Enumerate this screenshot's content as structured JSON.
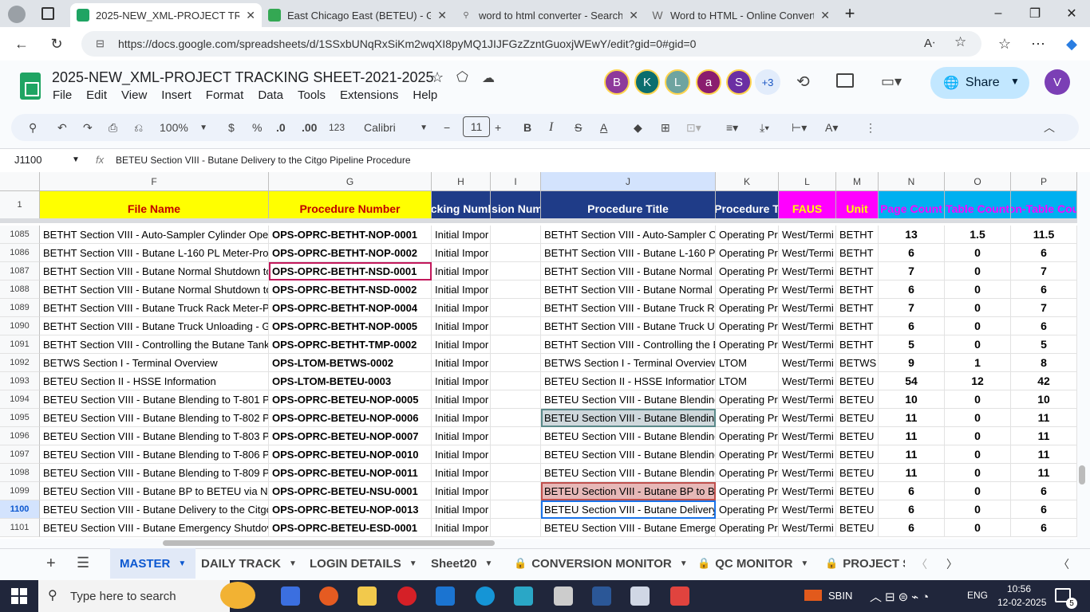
{
  "browser": {
    "tabs": [
      {
        "label": "2025-NEW_XML-PROJECT TRACKI",
        "active": true
      },
      {
        "label": "East Chicago East (BETEU) - Goog",
        "active": false
      },
      {
        "label": "word to html converter - Search",
        "active": false
      },
      {
        "label": "Word to HTML - Online Convert",
        "active": false
      }
    ],
    "url": "https://docs.google.com/spreadsheets/d/1SSxbUNqRxSiKm2wqXI8pyMQ1JIJFGzZzntGuoxjWEwY/edit?gid=0#gid=0"
  },
  "sheet": {
    "title": "2025-NEW_XML-PROJECT TRACKING SHEET-2021-2025",
    "menu": [
      "File",
      "Edit",
      "View",
      "Insert",
      "Format",
      "Data",
      "Tools",
      "Extensions",
      "Help"
    ],
    "avatars": [
      {
        "letter": "B",
        "color": "#8e3a9b"
      },
      {
        "letter": "K",
        "color": "#0b6e6e"
      },
      {
        "letter": "L",
        "color": "#6ea4a0"
      },
      {
        "letter": "a",
        "color": "#8a1d6f"
      },
      {
        "letter": "S",
        "color": "#6b2fa3"
      },
      {
        "letter": "+3",
        "color": "#e2ecfb"
      }
    ],
    "share_label": "Share",
    "user_avatar": "V"
  },
  "toolbar": {
    "zoom": "100%",
    "currency": "$",
    "percent": "%",
    "dec_minus": ".0",
    "dec_plus": ".00",
    "number_format": "123",
    "font": "Calibri",
    "font_size": "11"
  },
  "formula_bar": {
    "cell_ref": "J1100",
    "fx": "fx",
    "content": "BETEU Section VIII - Butane Delivery to the Citgo Pipeline Procedure"
  },
  "columns": [
    {
      "letter": "F",
      "header": "File Name",
      "bg": "#ffff00",
      "color": "#c00000"
    },
    {
      "letter": "G",
      "header": "Procedure Number",
      "bg": "#ffff00",
      "color": "#c00000"
    },
    {
      "letter": "H",
      "header": "cking Numl",
      "bg": "#1f3c88",
      "color": "#ffffff"
    },
    {
      "letter": "I",
      "header": "ision Num",
      "bg": "#1f3c88",
      "color": "#ffffff"
    },
    {
      "letter": "J",
      "header": "Procedure Title",
      "bg": "#1f3c88",
      "color": "#ffffff"
    },
    {
      "letter": "K",
      "header": "Procedure T",
      "bg": "#1f3c88",
      "color": "#ffffff"
    },
    {
      "letter": "L",
      "header": "FAUS",
      "bg": "#ff00ff",
      "color": "#ffff00"
    },
    {
      "letter": "M",
      "header": "Unit",
      "bg": "#ff00ff",
      "color": "#ffff00"
    },
    {
      "letter": "N",
      "header": "Page Count",
      "bg": "#00b0f0",
      "color": "#ff00ff"
    },
    {
      "letter": "O",
      "header": "Table Count",
      "bg": "#00b0f0",
      "color": "#ff00ff"
    },
    {
      "letter": "P",
      "header": "on-Table Cou",
      "bg": "#00b0f0",
      "color": "#ff00ff"
    }
  ],
  "header_row_number": "1",
  "rows": [
    {
      "n": "1085",
      "F": "BETHT Section VIII - Auto-Sampler Cylinder Ope",
      "G": "OPS-OPRC-BETHT-NOP-0001",
      "H": "Initial Impor",
      "I": "",
      "J": "BETHT Section VIII - Auto-Sampler Cy",
      "K": "Operating Pr",
      "L": "West/Termi",
      "M": "BETHT",
      "N": "13",
      "O": "1.5",
      "P": "11.5"
    },
    {
      "n": "1086",
      "F": "BETHT Section VIII - Butane L-160 PL Meter-Prov",
      "G": "OPS-OPRC-BETHT-NOP-0002",
      "H": "Initial Impor",
      "I": "",
      "J": "BETHT Section VIII - Butane L-160 PL",
      "K": "Operating Pr",
      "L": "West/Termi",
      "M": "BETHT",
      "N": "6",
      "O": "0",
      "P": "6"
    },
    {
      "n": "1087",
      "F": "BETHT Section VIII - Butane Normal Shutdown to",
      "G": "OPS-OPRC-BETHT-NSD-0001",
      "H": "Initial Impor",
      "I": "",
      "J": "BETHT Section VIII - Butane Normal S",
      "K": "Operating Pr",
      "L": "West/Termi",
      "M": "BETHT",
      "N": "7",
      "O": "0",
      "P": "7"
    },
    {
      "n": "1088",
      "F": "BETHT Section VIII - Butane Normal Shutdown to",
      "G": "OPS-OPRC-BETHT-NSD-0002",
      "H": "Initial Impor",
      "I": "",
      "J": "BETHT Section VIII - Butane Normal S",
      "K": "Operating Pr",
      "L": "West/Termi",
      "M": "BETHT",
      "N": "6",
      "O": "0",
      "P": "6"
    },
    {
      "n": "1089",
      "F": "BETHT Section VIII - Butane Truck Rack Meter-Pr",
      "G": "OPS-OPRC-BETHT-NOP-0004",
      "H": "Initial Impor",
      "I": "",
      "J": "BETHT Section VIII - Butane Truck Ra",
      "K": "Operating Pr",
      "L": "West/Termi",
      "M": "BETHT",
      "N": "7",
      "O": "0",
      "P": "7"
    },
    {
      "n": "1090",
      "F": "BETHT Section VIII - Butane Truck Unloading - G",
      "G": "OPS-OPRC-BETHT-NOP-0005",
      "H": "Initial Impor",
      "I": "",
      "J": "BETHT Section VIII - Butane Truck Ur",
      "K": "Operating Pr",
      "L": "West/Termi",
      "M": "BETHT",
      "N": "6",
      "O": "0",
      "P": "6"
    },
    {
      "n": "1091",
      "F": "BETHT Section VIII - Controlling the Butane Tank",
      "G": "OPS-OPRC-BETHT-TMP-0002",
      "H": "Initial Impor",
      "I": "",
      "J": "BETHT Section VIII - Controlling the E",
      "K": "Operating Pr",
      "L": "West/Termi",
      "M": "BETHT",
      "N": "5",
      "O": "0",
      "P": "5"
    },
    {
      "n": "1092",
      "F": "BETWS Section I - Terminal Overview",
      "G": "OPS-LTOM-BETWS-0002",
      "H": "Initial Impor",
      "I": "",
      "J": "BETWS Section I - Terminal Overview",
      "K": "LTOM",
      "L": "West/Termi",
      "M": "BETWS",
      "N": "9",
      "O": "1",
      "P": "8"
    },
    {
      "n": "1093",
      "F": "BETEU Section II - HSSE Information",
      "G": "OPS-LTOM-BETEU-0003",
      "H": "Initial Impor",
      "I": "",
      "J": "BETEU Section II - HSSE Information",
      "K": "LTOM",
      "L": "West/Termi",
      "M": "BETEU",
      "N": "54",
      "O": "12",
      "P": "42"
    },
    {
      "n": "1094",
      "F": "BETEU Section VIII - Butane Blending to T-801 Pr",
      "G": "OPS-OPRC-BETEU-NOP-0005",
      "H": "Initial Impor",
      "I": "",
      "J": "BETEU Section VIII - Butane Blending",
      "K": "Operating Pr",
      "L": "West/Termi",
      "M": "BETEU",
      "N": "10",
      "O": "0",
      "P": "10"
    },
    {
      "n": "1095",
      "F": "BETEU Section VIII - Butane Blending to T-802 Pr",
      "G": "OPS-OPRC-BETEU-NOP-0006",
      "H": "Initial Impor",
      "I": "",
      "J": "BETEU Section VIII - Butane Blending",
      "K": "Operating Pr",
      "L": "West/Termi",
      "M": "BETEU",
      "N": "11",
      "O": "0",
      "P": "11"
    },
    {
      "n": "1096",
      "F": "BETEU Section VIII - Butane Blending to T-803 Pr",
      "G": "OPS-OPRC-BETEU-NOP-0007",
      "H": "Initial Impor",
      "I": "",
      "J": "BETEU Section VIII - Butane Blending",
      "K": "Operating Pr",
      "L": "West/Termi",
      "M": "BETEU",
      "N": "11",
      "O": "0",
      "P": "11"
    },
    {
      "n": "1097",
      "F": "BETEU Section VIII - Butane Blending to T-806 Pr",
      "G": "OPS-OPRC-BETEU-NOP-0010",
      "H": "Initial Impor",
      "I": "",
      "J": "BETEU Section VIII - Butane Blending",
      "K": "Operating Pr",
      "L": "West/Termi",
      "M": "BETEU",
      "N": "11",
      "O": "0",
      "P": "11"
    },
    {
      "n": "1098",
      "F": "BETEU Section VIII - Butane Blending to T-809 Pr",
      "G": "OPS-OPRC-BETEU-NOP-0011",
      "H": "Initial Impor",
      "I": "",
      "J": "BETEU Section VIII - Butane Blending",
      "K": "Operating Pr",
      "L": "West/Termi",
      "M": "BETEU",
      "N": "11",
      "O": "0",
      "P": "11"
    },
    {
      "n": "1099",
      "F": "BETEU Section VIII - Butane BP to BETEU via Nir",
      "G": "OPS-OPRC-BETEU-NSU-0001",
      "H": "Initial Impor",
      "I": "",
      "J": "BETEU Section VIII - Butane BP to BE",
      "K": "Operating Pr",
      "L": "West/Termi",
      "M": "BETEU",
      "N": "6",
      "O": "0",
      "P": "6"
    },
    {
      "n": "1100",
      "F": "BETEU Section VIII - Butane Delivery to the Citgo",
      "G": "OPS-OPRC-BETEU-NOP-0013",
      "H": "Initial Impor",
      "I": "",
      "J": "BETEU Section VIII - Butane Delivery",
      "K": "Operating Pr",
      "L": "West/Termi",
      "M": "BETEU",
      "N": "6",
      "O": "0",
      "P": "6"
    },
    {
      "n": "1101",
      "F": "BETEU Section VIII - Butane Emergency Shutdov",
      "G": "OPS-OPRC-BETEU-ESD-0001",
      "H": "Initial Impor",
      "I": "",
      "J": "BETEU Section VIII - Butane Emerger",
      "K": "Operating Pr",
      "L": "West/Termi",
      "M": "BETEU",
      "N": "6",
      "O": "0",
      "P": "6"
    }
  ],
  "sheet_tabs": [
    {
      "label": "MASTER",
      "active": true,
      "locked": false
    },
    {
      "label": "DAILY TRACK",
      "active": false,
      "locked": false
    },
    {
      "label": "LOGIN DETAILS",
      "active": false,
      "locked": false
    },
    {
      "label": "Sheet20",
      "active": false,
      "locked": false
    },
    {
      "label": "CONVERSION MONITOR",
      "active": false,
      "locked": true
    },
    {
      "label": "QC MONITOR",
      "active": false,
      "locked": true
    },
    {
      "label": "PROJECT S",
      "active": false,
      "locked": true
    }
  ],
  "taskbar": {
    "search_placeholder": "Type here to search",
    "stock": "SBIN",
    "lang": "ENG",
    "time": "10:56",
    "date": "12-02-2025",
    "notif_count": "5"
  }
}
